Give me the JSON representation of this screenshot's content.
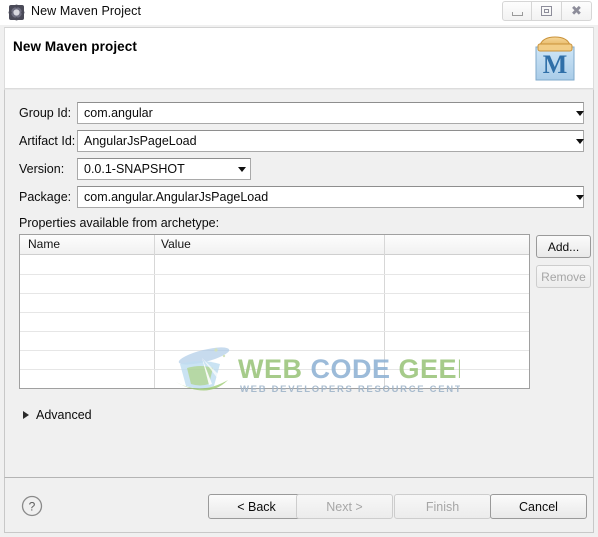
{
  "window": {
    "title": "New Maven Project",
    "icon": "gear-icon",
    "controls": {
      "minimize": "minimize-icon",
      "restore": "restore-icon",
      "close": "close-icon"
    }
  },
  "header": {
    "title": "New Maven project",
    "logo": "maven-logo-icon",
    "logo_letter": "M"
  },
  "form": {
    "fields": [
      {
        "label": "Group Id:",
        "value": "com.angular",
        "type": "combo",
        "width": "wide"
      },
      {
        "label": "Artifact Id:",
        "value": "AngularJsPageLoad",
        "type": "combo",
        "width": "wide"
      },
      {
        "label": "Version:",
        "value": "0.0.1-SNAPSHOT",
        "type": "combo",
        "width": "narrow"
      },
      {
        "label": "Package:",
        "value": "com.angular.AngularJsPageLoad",
        "type": "combo",
        "width": "wide"
      }
    ]
  },
  "properties": {
    "label": "Properties available from archetype:",
    "columns": [
      "Name",
      "Value",
      ""
    ],
    "rows": [],
    "buttons": {
      "add": {
        "label": "Add...",
        "enabled": true
      },
      "remove": {
        "label": "Remove",
        "enabled": false
      }
    }
  },
  "advanced": {
    "label": "Advanced",
    "expanded": false,
    "chevron": "triangle-right-icon"
  },
  "watermark": {
    "title": "WEB CODE GEEKS",
    "subtitle": "WEB DEVELOPERS RESOURCE CENTER",
    "colors": {
      "green": "#8cc06a",
      "blue": "#7fa8cd"
    }
  },
  "footer": {
    "help": "help-icon",
    "buttons": [
      {
        "label": "< Back",
        "enabled": true
      },
      {
        "label": "Next >",
        "enabled": false
      },
      {
        "label": "Finish",
        "enabled": false
      },
      {
        "label": "Cancel",
        "enabled": true
      }
    ]
  },
  "colors": {
    "dialog_bg": "#f0f0f0",
    "panel_bg": "#ffffff",
    "border": "#c8c8c8",
    "text": "#0b0b0b",
    "disabled_text": "#a6a6a6"
  }
}
